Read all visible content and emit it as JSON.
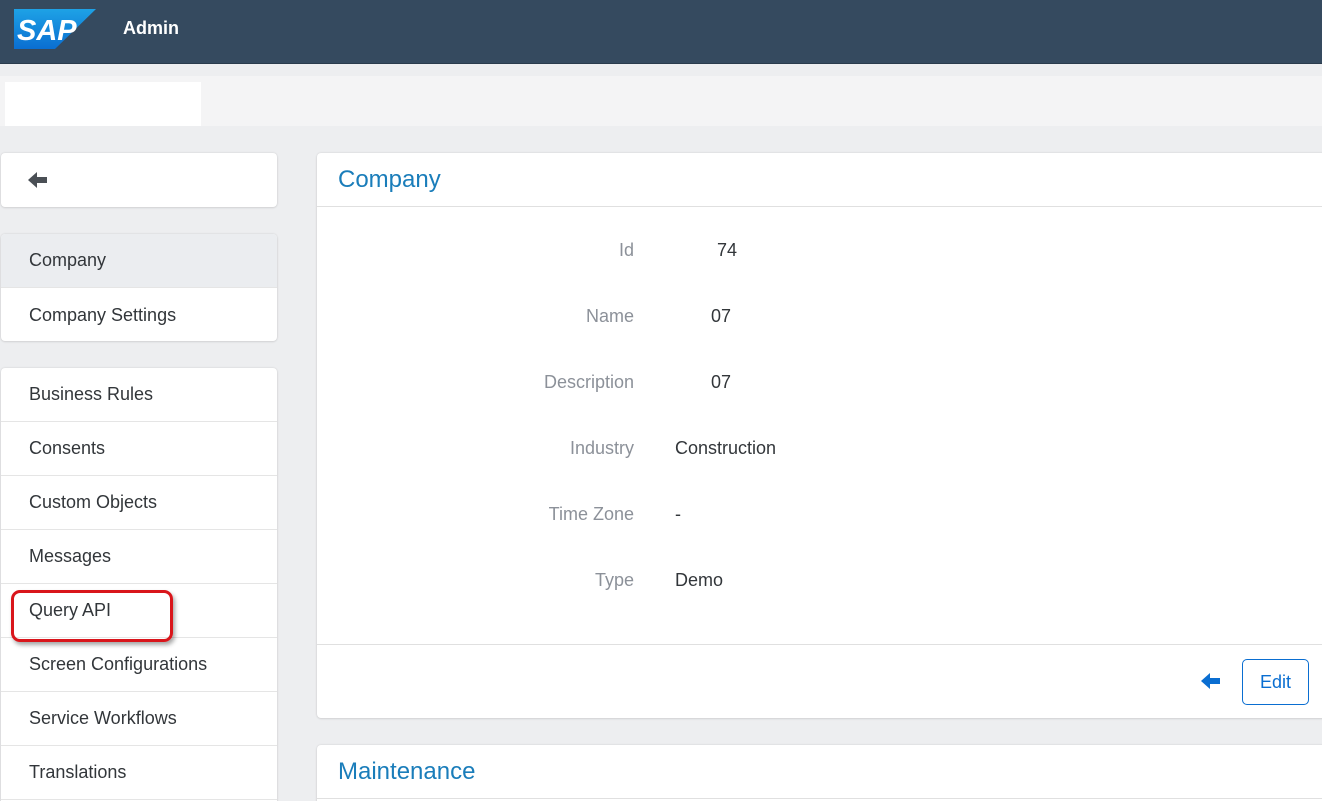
{
  "shell": {
    "logo_text": "SAP",
    "app_title": "Admin"
  },
  "nav": {
    "group1": [
      {
        "label": "Company",
        "selected": true
      },
      {
        "label": "Company Settings"
      }
    ],
    "group2": [
      {
        "label": "Business Rules"
      },
      {
        "label": "Consents"
      },
      {
        "label": "Custom Objects"
      },
      {
        "label": "Messages"
      },
      {
        "label": "Query API"
      },
      {
        "label": "Screen Configurations"
      },
      {
        "label": "Service Workflows"
      },
      {
        "label": "Translations"
      }
    ]
  },
  "company": {
    "title": "Company",
    "fields": [
      {
        "label": "Id",
        "value": "74"
      },
      {
        "label": "Name",
        "value": "07"
      },
      {
        "label": "Description",
        "value": "07"
      },
      {
        "label": "Industry",
        "value": "Construction"
      },
      {
        "label": "Time Zone",
        "value": "-"
      },
      {
        "label": "Type",
        "value": "Demo"
      }
    ],
    "edit_label": "Edit"
  },
  "maintenance": {
    "title": "Maintenance"
  },
  "colors": {
    "shell": "#354a5f",
    "accent": "#0a6ed1",
    "highlight": "#d9151b"
  }
}
